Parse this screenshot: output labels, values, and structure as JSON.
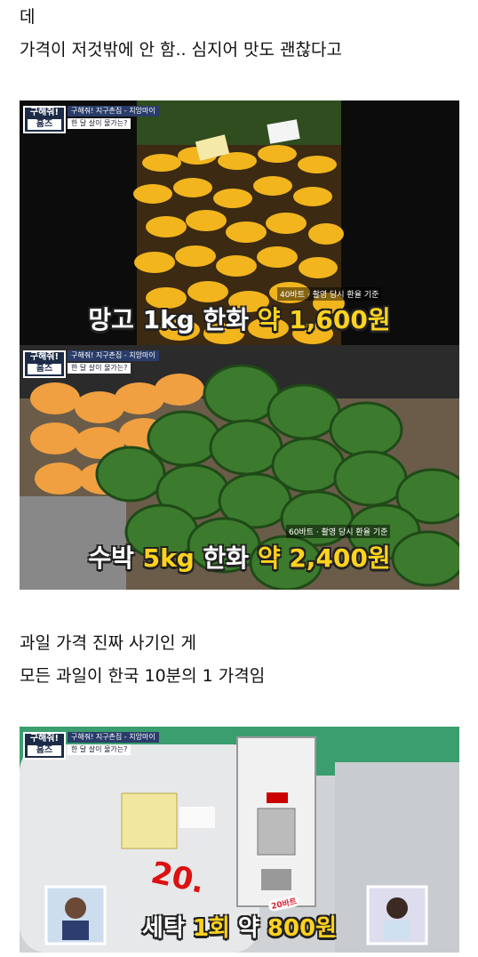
{
  "lines": {
    "l1": "데",
    "l2": "가격이 저것밖에 안 함.. 심지어 맛도 괜찮다고",
    "l3": "과일 가격 진짜 사기인 게",
    "l4": "모든 과일이 한국 10분의 1 가격임"
  },
  "show": {
    "badge_top": "구해줘!",
    "badge_bottom": "홈즈",
    "sub1": "구해줘! 지구촌집 - 치앙마이",
    "sub2": "한 달 살이 물가는?"
  },
  "frame1": {
    "note": "40바트 · 촬영 당시 환율 기준",
    "cap_a": "망고 1kg 한화 ",
    "cap_b": "약 1,600원"
  },
  "frame2": {
    "note": "60바트 · 촬영 당시 환율 기준",
    "cap_a": "수박 ",
    "cap_b": "5kg",
    "cap_c": " 한화 ",
    "cap_d": "약 2,400원"
  },
  "frame3": {
    "baht": "20바트",
    "tag": "20.",
    "cap_a": "세탁 ",
    "cap_b": "1회",
    "cap_c": " 약 ",
    "cap_d": "800원"
  }
}
